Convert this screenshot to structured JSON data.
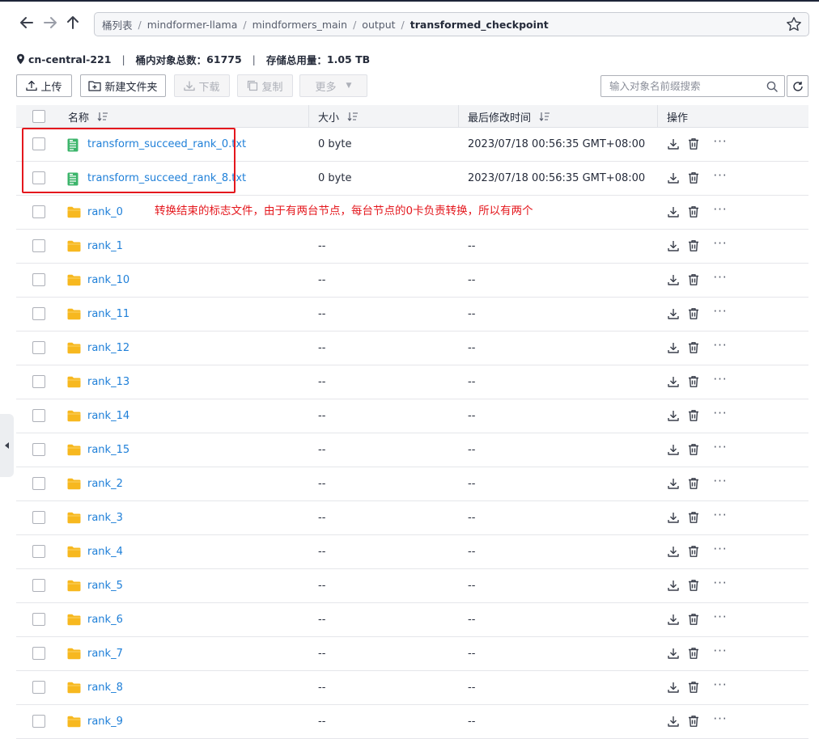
{
  "breadcrumb": {
    "items": [
      "桶列表",
      "mindformer-llama",
      "mindformers_main",
      "output"
    ],
    "current": "transformed_checkpoint"
  },
  "info": {
    "region": "cn-central-221",
    "object_count_label": "桶内对象总数：",
    "object_count": "61775",
    "storage_label": "存储总用量：",
    "storage": "1.05 TB"
  },
  "toolbar": {
    "upload": "上传",
    "new_folder": "新建文件夹",
    "download": "下载",
    "copy": "复制",
    "more": "更多"
  },
  "search": {
    "placeholder": "输入对象名前缀搜索"
  },
  "table": {
    "headers": {
      "name": "名称",
      "size": "大小",
      "modified": "最后修改时间",
      "actions": "操作"
    },
    "more_glyph": "···",
    "rows": [
      {
        "name": "transform_succeed_rank_0.txt",
        "type": "file",
        "size": "0 byte",
        "modified": "2023/07/18 00:56:35 GMT+08:00"
      },
      {
        "name": "transform_succeed_rank_8.txt",
        "type": "file",
        "size": "0 byte",
        "modified": "2023/07/18 00:56:35 GMT+08:00"
      },
      {
        "name": "rank_0",
        "type": "folder",
        "size": "",
        "modified": ""
      },
      {
        "name": "rank_1",
        "type": "folder",
        "size": "--",
        "modified": "--"
      },
      {
        "name": "rank_10",
        "type": "folder",
        "size": "--",
        "modified": "--"
      },
      {
        "name": "rank_11",
        "type": "folder",
        "size": "--",
        "modified": "--"
      },
      {
        "name": "rank_12",
        "type": "folder",
        "size": "--",
        "modified": "--"
      },
      {
        "name": "rank_13",
        "type": "folder",
        "size": "--",
        "modified": "--"
      },
      {
        "name": "rank_14",
        "type": "folder",
        "size": "--",
        "modified": "--"
      },
      {
        "name": "rank_15",
        "type": "folder",
        "size": "--",
        "modified": "--"
      },
      {
        "name": "rank_2",
        "type": "folder",
        "size": "--",
        "modified": "--"
      },
      {
        "name": "rank_3",
        "type": "folder",
        "size": "--",
        "modified": "--"
      },
      {
        "name": "rank_4",
        "type": "folder",
        "size": "--",
        "modified": "--"
      },
      {
        "name": "rank_5",
        "type": "folder",
        "size": "--",
        "modified": "--"
      },
      {
        "name": "rank_6",
        "type": "folder",
        "size": "--",
        "modified": "--"
      },
      {
        "name": "rank_7",
        "type": "folder",
        "size": "--",
        "modified": "--"
      },
      {
        "name": "rank_8",
        "type": "folder",
        "size": "--",
        "modified": "--"
      },
      {
        "name": "rank_9",
        "type": "folder",
        "size": "--",
        "modified": "--"
      }
    ]
  },
  "annotation": {
    "text": "转换结束的标志文件，由于有两台节点，每台节点的0卡负责转换，所以有两个",
    "color": "#e4171d"
  },
  "colors": {
    "link": "#1e7fd8",
    "folder": "#f7b81f",
    "file": "#3cb56b"
  }
}
